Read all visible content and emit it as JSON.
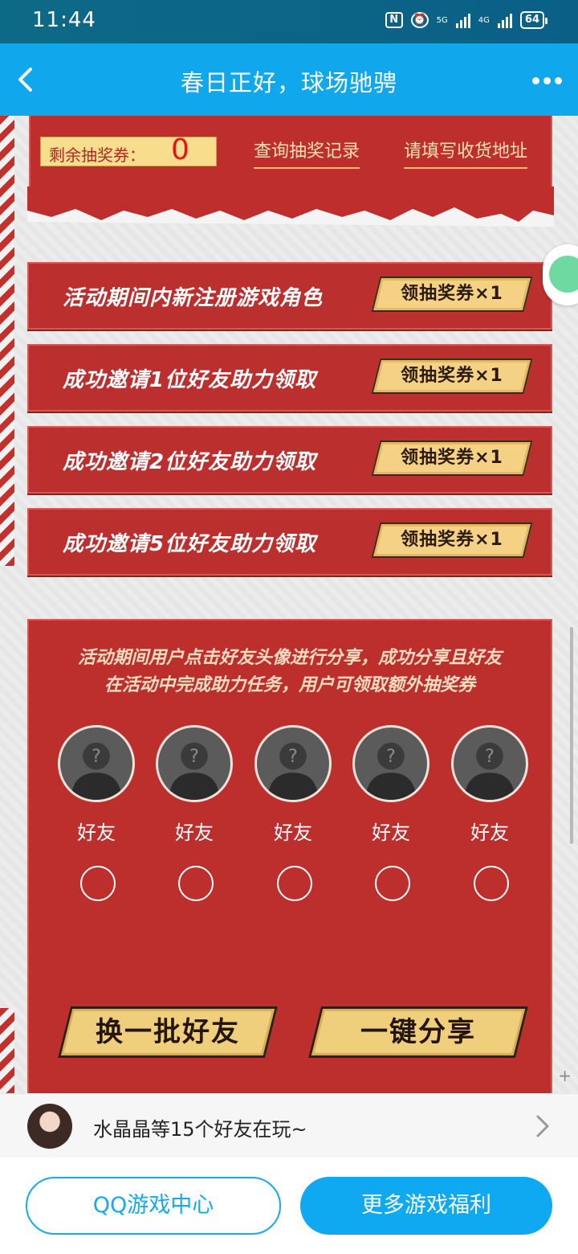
{
  "status_bar": {
    "time": "11:44",
    "nfc_icon": "nfc-icon",
    "alarm_icon": "alarm-icon",
    "signal1_label": "5G",
    "signal2_label": "4G",
    "battery": "64"
  },
  "title_bar": {
    "title": "春日正好，球场驰骋",
    "back_icon": "back-arrow-icon",
    "more_icon": "more-dots-icon"
  },
  "lottery": {
    "remaining_label": "剩余抽奖券：",
    "remaining_count": "0",
    "record_link": "查询抽奖记录",
    "address_link": "请填写收货地址"
  },
  "tasks": [
    {
      "label": "活动期间内新注册游戏角色",
      "button": "领抽奖券×1"
    },
    {
      "label": "成功邀请1位好友助力领取",
      "button": "领抽奖券×1"
    },
    {
      "label": "成功邀请2位好友助力领取",
      "button": "领抽奖券×1"
    },
    {
      "label": "成功邀请5位好友助力领取",
      "button": "领抽奖券×1"
    }
  ],
  "friends_section": {
    "description_line1": "活动期间用户点击好友头像进行分享，成功分享且好友",
    "description_line2": "在活动中完成助力任务，用户可领取额外抽奖券",
    "friends": [
      {
        "label": "好友"
      },
      {
        "label": "好友"
      },
      {
        "label": "好友"
      },
      {
        "label": "好友"
      },
      {
        "label": "好友"
      }
    ],
    "refresh_button": "换一批好友",
    "share_button": "一键分享"
  },
  "friends_strip": {
    "text": "水晶晶等15个好友在玩~"
  },
  "bottom_bar": {
    "game_center_button": "QQ游戏中心",
    "more_welfare_button": "更多游戏福利"
  },
  "colors": {
    "title_bar": "#11a7ec",
    "panel_red": "#bd2f2d",
    "gold": "#f4d184",
    "primary_blue": "#0fa9f2"
  }
}
